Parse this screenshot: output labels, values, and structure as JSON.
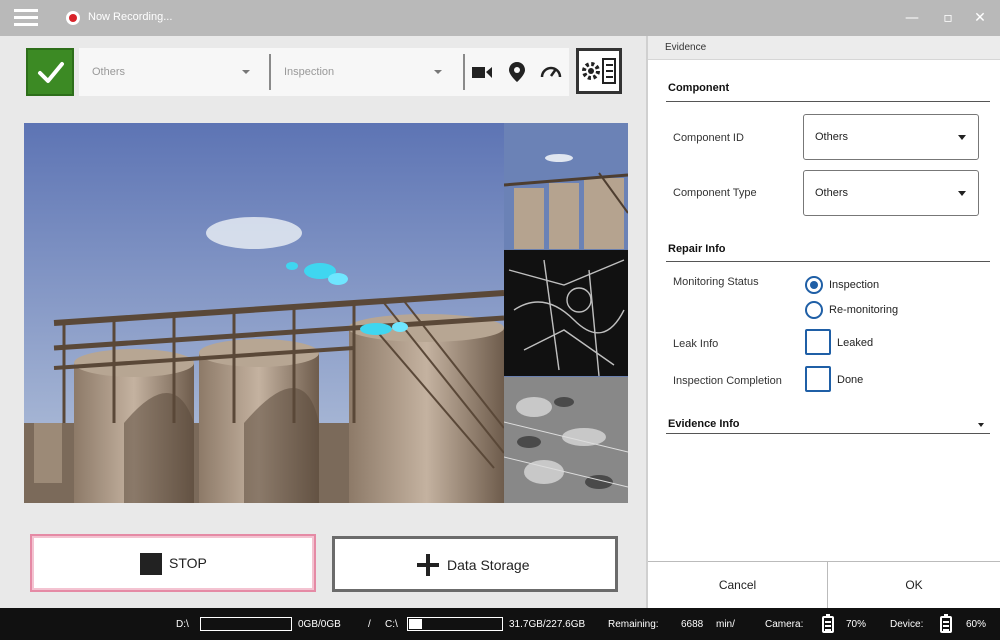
{
  "titlebar": {
    "status": "Now Recording...",
    "minimize_glyph": "—",
    "maximize_glyph": "▫",
    "close_glyph": "✕"
  },
  "toolbar": {
    "component_select": "Others",
    "monitoring_select": "Inspection",
    "icons": [
      "video-camera-icon",
      "location-pin-icon",
      "gauge-icon",
      "settings-panel-icon"
    ]
  },
  "video": {
    "thumbnails": [
      "rgb-view",
      "edge-view",
      "gas-view"
    ]
  },
  "controls": {
    "stop_label": "STOP",
    "data_storage_label": "Data Storage"
  },
  "evidence": {
    "header": "Evidence",
    "component": {
      "title": "Component",
      "id_label": "Component ID",
      "id_value": "Others",
      "type_label": "Component Type",
      "type_value": "Others"
    },
    "repair": {
      "title": "Repair Info",
      "monitoring_label": "Monitoring Status",
      "options": [
        "Inspection",
        "Re-monitoring"
      ],
      "selected": "Inspection",
      "leak_label": "Leak Info",
      "leak_option": "Leaked",
      "completion_label": "Inspection Completion",
      "completion_option": "Done"
    },
    "evidence_info": {
      "title": "Evidence Info"
    },
    "cancel_label": "Cancel",
    "ok_label": "OK"
  },
  "status": {
    "d_label": "D:\\",
    "d_value": "0GB/0GB",
    "d_fill": 0,
    "slash": "/",
    "c_label": "C:\\",
    "c_value": "31.7GB/227.6GB",
    "c_fill": 0.14,
    "remaining_label": "Remaining:",
    "remaining_value": "6688",
    "remaining_unit": "min/",
    "camera_label": "Camera:",
    "camera_value": "70%",
    "device_label": "Device:",
    "device_value": "60%"
  },
  "colors": {
    "accent_green": "#3c8a24",
    "record_red": "#d8232a",
    "radio_blue": "#1f5fa6",
    "stop_border": "#e58aa5",
    "gas_cyan": "#3fd6f0"
  }
}
